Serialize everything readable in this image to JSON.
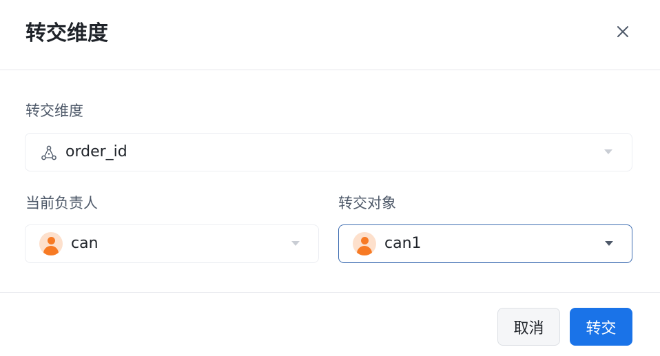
{
  "dialog": {
    "title": "转交维度",
    "close_icon": "close-icon"
  },
  "dimension": {
    "label": "转交维度",
    "icon": "dimension-icon",
    "value": "order_id"
  },
  "current_owner": {
    "label": "当前负责人",
    "value": "can"
  },
  "transfer_target": {
    "label": "转交对象",
    "value": "can1"
  },
  "footer": {
    "cancel_label": "取消",
    "confirm_label": "转交"
  },
  "colors": {
    "primary": "#1a73e8",
    "avatar_bg": "#fde0cc",
    "avatar_fg": "#f77a24",
    "active_border": "#3b6bb0"
  }
}
